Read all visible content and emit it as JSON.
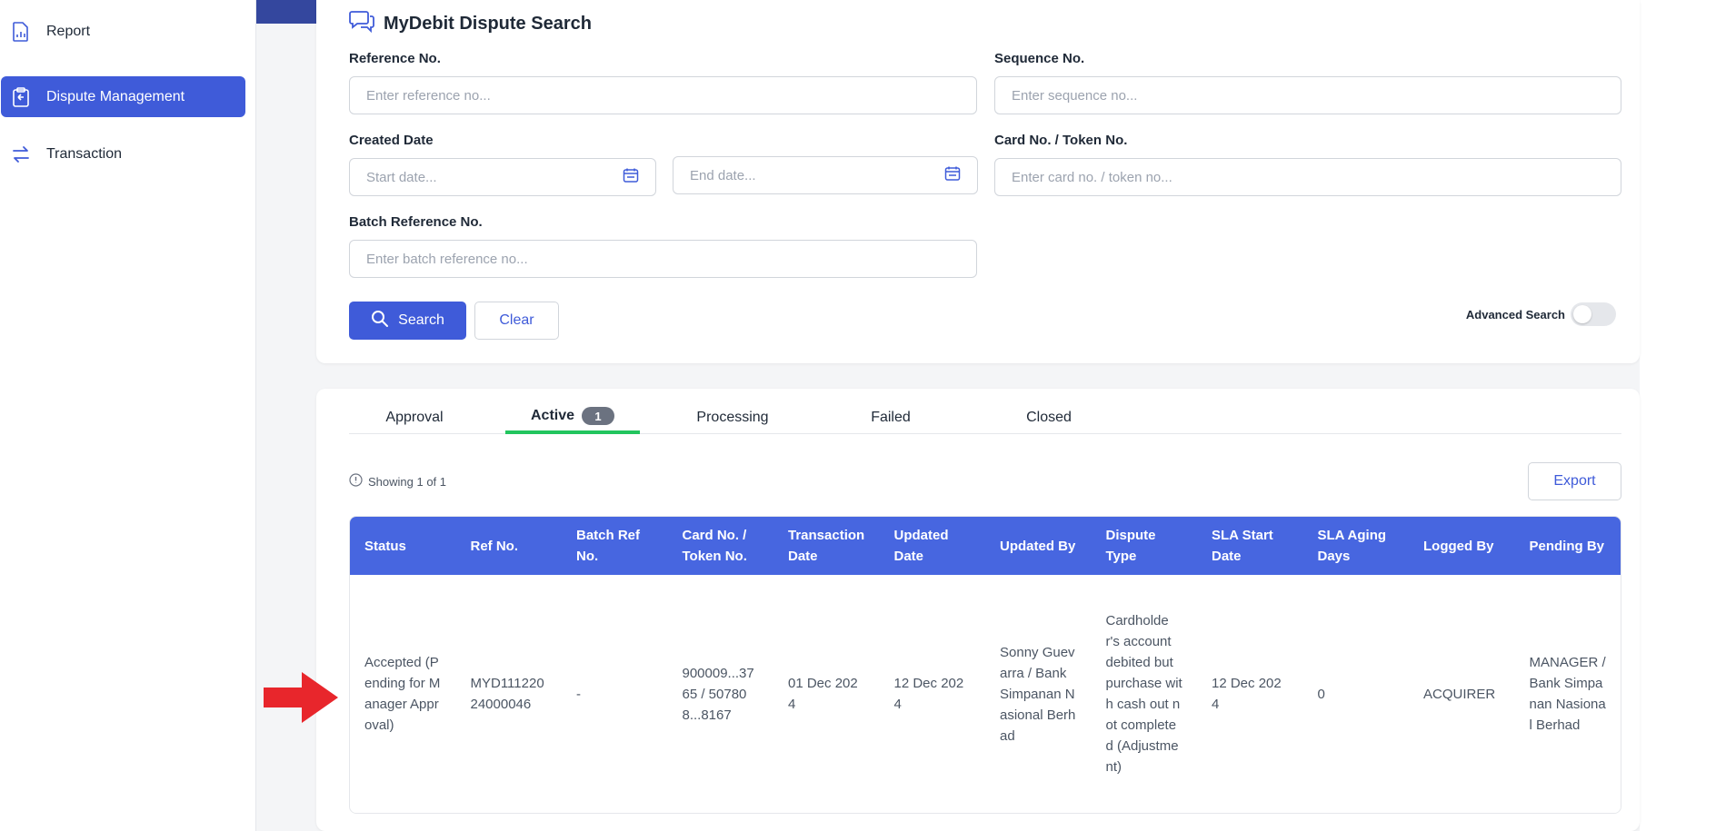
{
  "sidebar": {
    "items": [
      {
        "label": "Report",
        "icon": "report-icon",
        "active": false
      },
      {
        "label": "Dispute Management",
        "icon": "clipboard-icon",
        "active": true
      },
      {
        "label": "Transaction",
        "icon": "transfer-arrows-icon",
        "active": false
      }
    ]
  },
  "search": {
    "title": "MyDebit Dispute Search",
    "reference_label": "Reference No.",
    "reference_placeholder": "Enter reference no...",
    "sequence_label": "Sequence No.",
    "sequence_placeholder": "Enter sequence no...",
    "created_date_label": "Created Date",
    "start_placeholder": "Start date...",
    "end_placeholder": "End date...",
    "card_label": "Card No. / Token No.",
    "card_placeholder": "Enter card no. / token no...",
    "batch_label": "Batch Reference No.",
    "batch_placeholder": "Enter batch reference no...",
    "search_button": "Search",
    "clear_button": "Clear",
    "advanced_label": "Advanced Search",
    "advanced_enabled": false
  },
  "results": {
    "tabs": [
      {
        "label": "Approval"
      },
      {
        "label": "Active",
        "count": "1",
        "active": true
      },
      {
        "label": "Processing"
      },
      {
        "label": "Failed"
      },
      {
        "label": "Closed"
      }
    ],
    "showing": "Showing 1 of 1",
    "export_button": "Export",
    "columns": [
      "Status",
      "Ref No.",
      "Batch Ref No.",
      "Card No. / Token No.",
      "Transaction Date",
      "Updated Date",
      "Updated By",
      "Dispute Type",
      "SLA Start Date",
      "SLA Aging Days",
      "Logged By",
      "Pending By"
    ],
    "rows": [
      [
        "Accepted (Pending for Manager Approval)",
        "MYD11122024000046",
        "-",
        "900009...3765 / 507808...8167",
        "01 Dec 2024",
        "12 Dec 2024",
        "Sonny Guevarra / Bank Simpanan Nasional Berhad",
        "Cardholder's account debited but purchase with cash out not completed (Adjustment)",
        "12 Dec 2024",
        "0",
        "ACQUIRER",
        "MANAGER / Bank Simpanan Nasional Berhad"
      ]
    ]
  },
  "colors": {
    "primary": "#3f5bd9",
    "table_header": "#4766e0",
    "active_tab": "#22c55e",
    "arrow": "#e8262c"
  }
}
